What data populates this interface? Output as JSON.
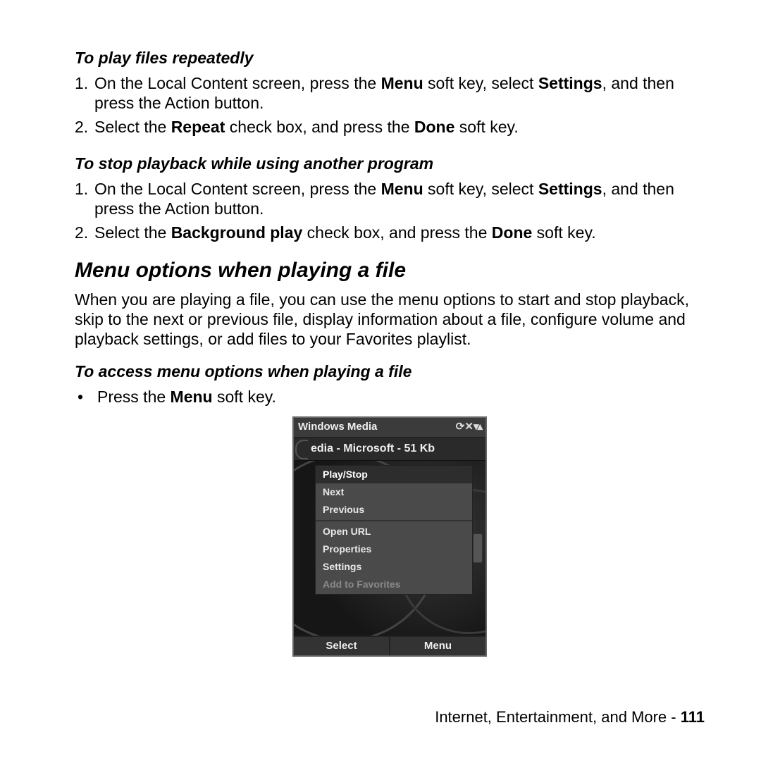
{
  "sec1": {
    "title": "To play files repeatedly",
    "step1_a": "On the Local Content screen, press the ",
    "step1_b": "Menu",
    "step1_c": " soft key, select ",
    "step1_d": "Settings",
    "step1_e": ", and then press the Action button.",
    "step2_a": "Select the ",
    "step2_b": "Repeat",
    "step2_c": " check box, and press the ",
    "step2_d": "Done",
    "step2_e": " soft key."
  },
  "sec2": {
    "title": "To stop playback while using another program",
    "step1_a": "On the Local Content screen, press the ",
    "step1_b": "Menu",
    "step1_c": " soft key, select ",
    "step1_d": "Settings",
    "step1_e": ", and then press the Action button.",
    "step2_a": "Select the ",
    "step2_b": "Background play",
    "step2_c": " check box, and press the ",
    "step2_d": "Done",
    "step2_e": " soft key."
  },
  "main": {
    "title": "Menu options when playing a file",
    "para": "When you are playing a file, you can use the menu options to start and stop playback, skip to the next or previous file, display information about a file, configure volume and playback settings, or add files to your Favorites playlist."
  },
  "sec3": {
    "title": "To access menu options when playing a file",
    "bullet_a": "Press the ",
    "bullet_b": "Menu",
    "bullet_c": " soft key."
  },
  "phone": {
    "title": "Windows Media",
    "subtitle": "edia - Microsoft - 51 Kb",
    "items": [
      "Play/Stop",
      "Next",
      "Previous",
      "Open URL",
      "Properties",
      "Settings",
      "Add to Favorites"
    ],
    "soft_left": "Select",
    "soft_right": "Menu"
  },
  "footer": {
    "text": "Internet, Entertainment, and More - ",
    "page": "111"
  },
  "nums": {
    "n1": "1.",
    "n2": "2.",
    "dot": "•"
  }
}
